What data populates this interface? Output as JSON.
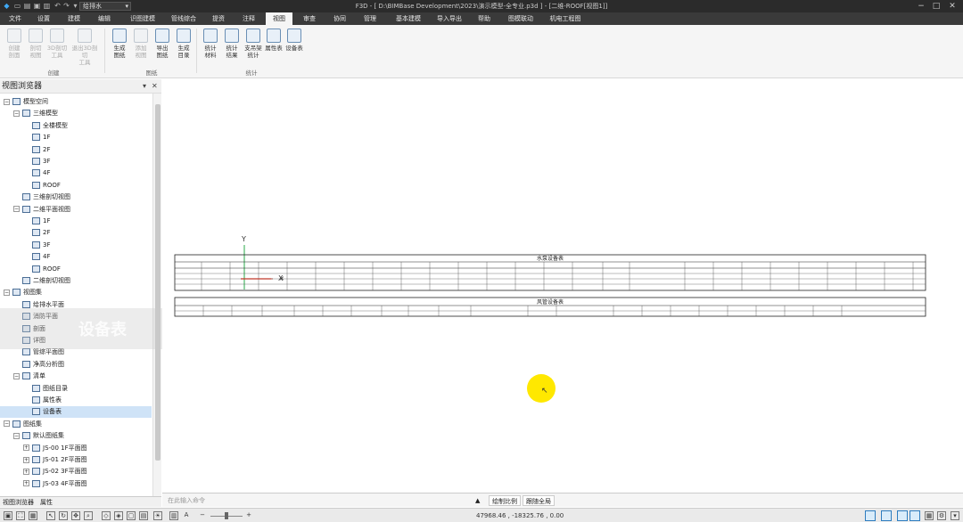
{
  "titlebar": {
    "combo_value": "给排水",
    "title": "F3D - [ D:\\BIMBase Development\\2023\\演示模型-全专业.p3d ] - [二维-ROOF[视图1]]",
    "quick_icons": [
      "app-logo-icon",
      "new-icon",
      "open-icon",
      "save-icon",
      "save-as-icon",
      "undo-icon",
      "redo-icon",
      "dropdown-icon"
    ],
    "window_controls": [
      "−",
      "□",
      "✕"
    ]
  },
  "menu": {
    "tabs": [
      "文件",
      "设置",
      "建模",
      "编辑",
      "识图建模",
      "管线综合",
      "提资",
      "注释",
      "视图",
      "审查",
      "协同",
      "管理",
      "基本建模",
      "导入导出",
      "帮助",
      "图模联动",
      "机电工程图"
    ],
    "active": "视图"
  },
  "ribbon": {
    "buttons": [
      {
        "label1": "创建",
        "label2": "剖面",
        "disabled": true,
        "icon": "section-icon"
      },
      {
        "label1": "剖切",
        "label2": "视图",
        "disabled": true,
        "icon": "cut-view-icon"
      },
      {
        "label1": "3D剖切",
        "label2": "工具",
        "disabled": true,
        "icon": "3d-cut-icon"
      },
      {
        "label1": "退出3D剖切",
        "label2": "工具",
        "disabled": true,
        "icon": "exit-3d-cut-icon"
      },
      {
        "label1": "生成",
        "label2": "图纸",
        "disabled": false,
        "icon": "generate-drawing-icon"
      },
      {
        "label1": "添加",
        "label2": "视图",
        "disabled": true,
        "icon": "add-view-icon"
      },
      {
        "label1": "导出",
        "label2": "图纸",
        "disabled": false,
        "icon": "export-drawing-icon"
      },
      {
        "label1": "生成",
        "label2": "目录",
        "disabled": false,
        "icon": "generate-catalog-icon"
      },
      {
        "label1": "统计",
        "label2": "材料",
        "disabled": false,
        "icon": "stat-material-icon"
      },
      {
        "label1": "统计",
        "label2": "结果",
        "disabled": false,
        "icon": "stat-result-icon"
      },
      {
        "label1": "支吊架",
        "label2": "统计",
        "disabled": false,
        "icon": "hanger-stat-icon"
      },
      {
        "label1": "属性表",
        "label2": "",
        "disabled": false,
        "icon": "property-table-icon"
      },
      {
        "label1": "设备表",
        "label2": "",
        "disabled": false,
        "icon": "equipment-table-icon"
      }
    ],
    "groups": [
      "创建",
      "图纸",
      "统计"
    ]
  },
  "browser": {
    "title": "视图浏览器",
    "pin": "▾",
    "close": "✕",
    "rows": [
      {
        "text": "模型空间",
        "level": 0,
        "exp": "⊟"
      },
      {
        "text": "三维模型",
        "level": 1,
        "exp": "⊟"
      },
      {
        "text": "全楼模型",
        "level": 2,
        "exp": ""
      },
      {
        "text": "1F",
        "level": 2,
        "exp": ""
      },
      {
        "text": "2F",
        "level": 2,
        "exp": ""
      },
      {
        "text": "3F",
        "level": 2,
        "exp": ""
      },
      {
        "text": "4F",
        "level": 2,
        "exp": ""
      },
      {
        "text": "ROOF",
        "level": 2,
        "exp": ""
      },
      {
        "text": "三维剖切视图",
        "level": 1,
        "exp": ""
      },
      {
        "text": "二维平面视图",
        "level": 1,
        "exp": "⊟"
      },
      {
        "text": "1F",
        "level": 2,
        "exp": ""
      },
      {
        "text": "2F",
        "level": 2,
        "exp": ""
      },
      {
        "text": "3F",
        "level": 2,
        "exp": ""
      },
      {
        "text": "4F",
        "level": 2,
        "exp": ""
      },
      {
        "text": "ROOF",
        "level": 2,
        "exp": ""
      },
      {
        "text": "二维剖切视图",
        "level": 1,
        "exp": ""
      },
      {
        "text": "视图集",
        "level": 0,
        "exp": "⊟"
      },
      {
        "text": "给排水平面",
        "level": 1,
        "exp": ""
      },
      {
        "text": "消防平面",
        "level": 1,
        "exp": ""
      },
      {
        "text": "剖面",
        "level": 1,
        "exp": ""
      },
      {
        "text": "详图",
        "level": 1,
        "exp": ""
      },
      {
        "text": "管综平面图",
        "level": 1,
        "exp": ""
      },
      {
        "text": "净高分析图",
        "level": 1,
        "exp": ""
      },
      {
        "text": "清单",
        "level": 1,
        "exp": "⊟"
      },
      {
        "text": "图纸目录",
        "level": 2,
        "exp": ""
      },
      {
        "text": "属性表",
        "level": 2,
        "exp": ""
      },
      {
        "text": "设备表",
        "level": 2,
        "exp": "",
        "selected": true
      },
      {
        "text": "图纸集",
        "level": 0,
        "exp": "⊟"
      },
      {
        "text": "默认图纸集",
        "level": 1,
        "exp": "⊟"
      },
      {
        "text": "JS-00 1F平面图",
        "level": 2,
        "exp": "⊞"
      },
      {
        "text": "JS-01 2F平面图",
        "level": 2,
        "exp": "⊞"
      },
      {
        "text": "JS-02 3F平面图",
        "level": 2,
        "exp": "⊞"
      },
      {
        "text": "JS-03 4F平面图",
        "level": 2,
        "exp": "⊞"
      }
    ],
    "watermark": "设备表",
    "tabs": [
      "视图浏览器",
      "属性"
    ]
  },
  "canvas": {
    "axis_y": "Y",
    "axis_x": "X",
    "table1_title": "水泵设备表",
    "table2_title": "风管设备表"
  },
  "cmdline": {
    "placeholder": "在此输入命令",
    "arrow": "▲",
    "scale_label": "绘制比例",
    "follow_label": "跟随全局"
  },
  "statusbar": {
    "coords": "47968.46 , -18325.76 , 0.00",
    "zoom_minus": "−",
    "zoom_plus": "+"
  },
  "colors": {
    "titlebar": "#2b2b2b",
    "menubar": "#3a3a3a",
    "cursor_highlight": "#ffe800",
    "axis_green": "#2aa84a",
    "axis_red": "#c0392b"
  }
}
